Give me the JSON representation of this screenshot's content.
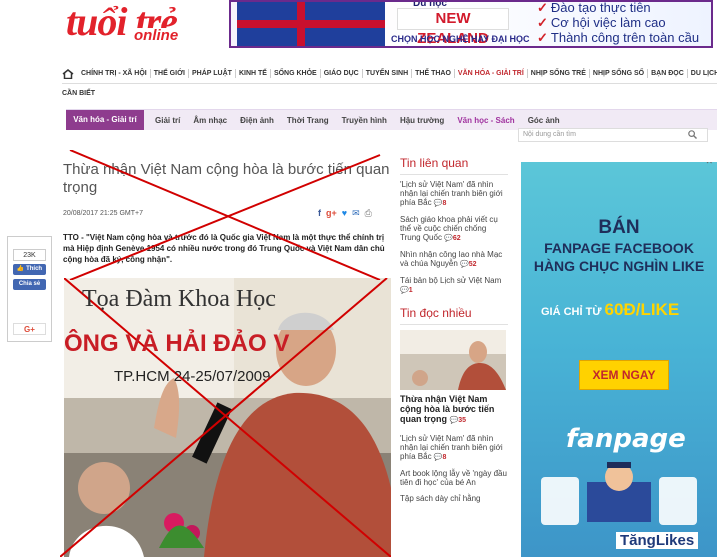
{
  "header": {
    "logo_main": "tuổi trẻ",
    "logo_sub": "online"
  },
  "banner": {
    "country_small": "Du học",
    "country": "NEW ZEALAND",
    "caption": "CHỌN HỌC NGHỀ HAY ĐẠI HỌC",
    "points": [
      "Đào tạo thực tiễn",
      "Cơ hội việc làm cao",
      "Thành công trên toàn cầu"
    ]
  },
  "nav": {
    "items": [
      "CHÍNH TRỊ - XÃ HỘI",
      "THẾ GIỚI",
      "PHÁP LUẬT",
      "KINH TẾ",
      "SỐNG KHỎE",
      "GIÁO DỤC",
      "TUYỂN SINH",
      "THỂ THAO",
      "VĂN HÓA - GIẢI TRÍ",
      "NHỊP SỐNG TRẺ",
      "NHỊP SỐNG SỐ",
      "BẠN ĐỌC",
      "DU LỊCH"
    ],
    "active_index": 8,
    "second_row": "CẦN BIẾT"
  },
  "section": {
    "active": "Văn hóa - Giải trí",
    "items": [
      "Giải trí",
      "Âm nhạc",
      "Điện ảnh",
      "Thời Trang",
      "Truyền hình",
      "Hậu trường",
      "Văn học - Sách",
      "Góc ảnh"
    ],
    "highlight_index": 6,
    "search_placeholder": "Nội dung cần tìm"
  },
  "article": {
    "title": "Thừa nhận Việt Nam cộng hòa là bước tiến quan trọng",
    "meta": "20/08/2017 21:25 GMT+7",
    "sapo": "TTO - \"Việt Nam cộng hòa và trước đó là Quốc gia Việt Nam là một thực thể chính trị mà Hiệp định Genève 1954 có nhiều nước trong đó Trung Quốc và Việt Nam dân chủ cộng hòa đã ký, công nhận\".",
    "photo_banner_1": "Tọa Đàm Khoa Học",
    "photo_banner_2": "ÔNG VÀ HẢI ĐẢO V",
    "photo_date": "TP.HCM 24-25/07/2009"
  },
  "share": {
    "count": "23K",
    "like": "Thích",
    "share": "Chia sẻ",
    "gplus": "G+"
  },
  "related": {
    "heading": "Tin liên quan",
    "links": [
      {
        "text": "'Lịch sử Việt Nam' đã nhìn nhận lại chiến tranh biên giới phía Bắc",
        "count": "8"
      },
      {
        "text": "Sách giáo khoa phải viết cụ thể về cuộc chiến chống Trung Quốc",
        "count": "62"
      },
      {
        "text": "Nhìn nhận công lao nhà Mạc và chúa Nguyễn",
        "count": "52"
      },
      {
        "text": "Tái bản bộ Lịch sử Việt Nam",
        "count": "1"
      }
    ]
  },
  "popular": {
    "heading": "Tin đọc nhiều",
    "featured": {
      "text": "Thừa nhận Việt Nam cộng hòa là bước tiến quan trọng",
      "count": "35"
    },
    "links": [
      {
        "text": "'Lịch sử Việt Nam' đã nhìn nhận lại chiến tranh biên giới phía Bắc",
        "count": "8"
      },
      {
        "text": "Art book lộng lẫy về 'ngày đầu tiên đi học' của bé An",
        "count": ""
      },
      {
        "text": "Tập sách dày chỉ hằng",
        "count": ""
      }
    ]
  },
  "ad": {
    "line1": "BÁN",
    "line2": "FANPAGE FACEBOOK",
    "line3": "HÀNG CHỤC NGHÌN LIKE",
    "price_prefix": "GIÁ CHỈ TỪ",
    "price": "60Đ/LIKE",
    "cta": "XEM NGAY",
    "brand": "fanpage",
    "bottom": "TăngLikes"
  }
}
